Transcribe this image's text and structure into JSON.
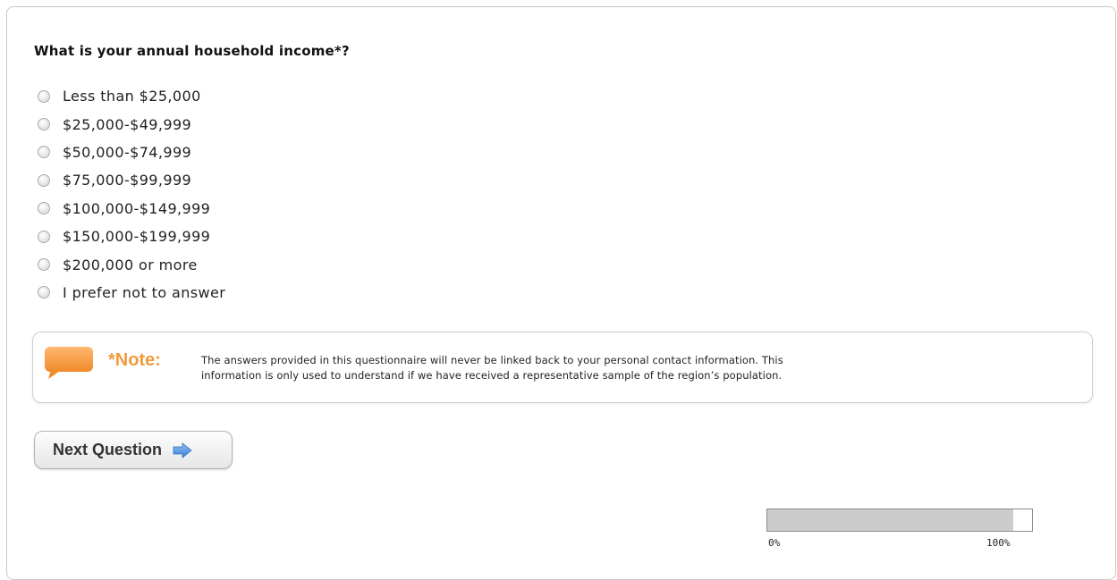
{
  "question": {
    "title": "What is your annual household income*?",
    "options": [
      "Less than $25,000",
      "$25,000-$49,999",
      "$50,000-$74,999",
      "$75,000-$99,999",
      "$100,000-$149,999",
      "$150,000-$199,999",
      "$200,000 or more",
      "I prefer not to answer"
    ],
    "selected": null
  },
  "note": {
    "label": "*Note:",
    "text_line1": "The answers provided in this questionnaire will never be linked back to your personal contact information. This",
    "text_line2": "information is only used to understand if we have received a representative sample of the region’s population.",
    "icon": "speech-bubble-icon",
    "accent_color": "#f09a3e"
  },
  "next_button": {
    "label": "Next Question",
    "icon": "right-arrow-icon",
    "icon_color": "#4a90e2"
  },
  "progress": {
    "value_fraction": 0.93,
    "min_label": "0%",
    "max_label": "100%"
  }
}
